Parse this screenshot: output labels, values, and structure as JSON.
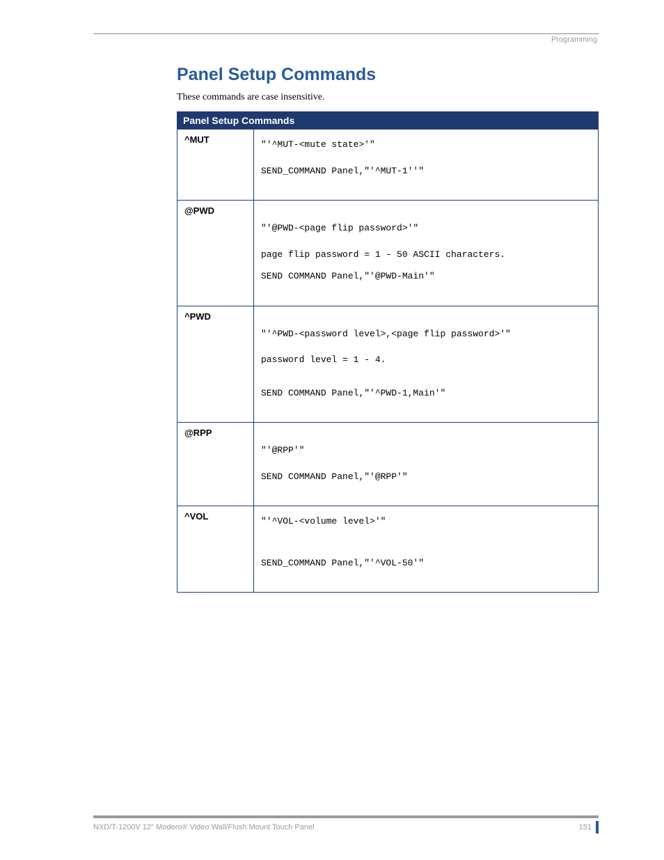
{
  "header": {
    "section_label": "Programming"
  },
  "title": "Panel Setup Commands",
  "intro": "These commands are case insensitive.",
  "table": {
    "header": "Panel Setup Commands",
    "rows": [
      {
        "name": "^MUT",
        "lines": [
          "\"'^MUT-<mute state>'\"",
          "SEND_COMMAND Panel,\"'^MUT-1''\""
        ]
      },
      {
        "name": "@PWD",
        "lines": [
          "\"'@PWD-<page flip password>'\"",
          "page flip password = 1 - 50 ASCII characters.",
          "SEND COMMAND Panel,\"'@PWD-Main'\""
        ]
      },
      {
        "name": "^PWD",
        "lines": [
          "\"'^PWD-<password level>,<page flip password>'\"",
          "password level = 1 - 4.",
          "SEND COMMAND Panel,\"'^PWD-1,Main'\""
        ]
      },
      {
        "name": "@RPP",
        "lines": [
          "\"'@RPP'\"",
          "SEND COMMAND Panel,\"'@RPP'\""
        ]
      },
      {
        "name": "^VOL",
        "lines": [
          "\"'^VOL-<volume level>'\"",
          "SEND_COMMAND Panel,\"'^VOL-50'\""
        ]
      }
    ]
  },
  "footer": {
    "product": "NXD/T-1200V 12\" Modero® Video Wall/Flush Mount Touch Panel",
    "page": "151"
  }
}
